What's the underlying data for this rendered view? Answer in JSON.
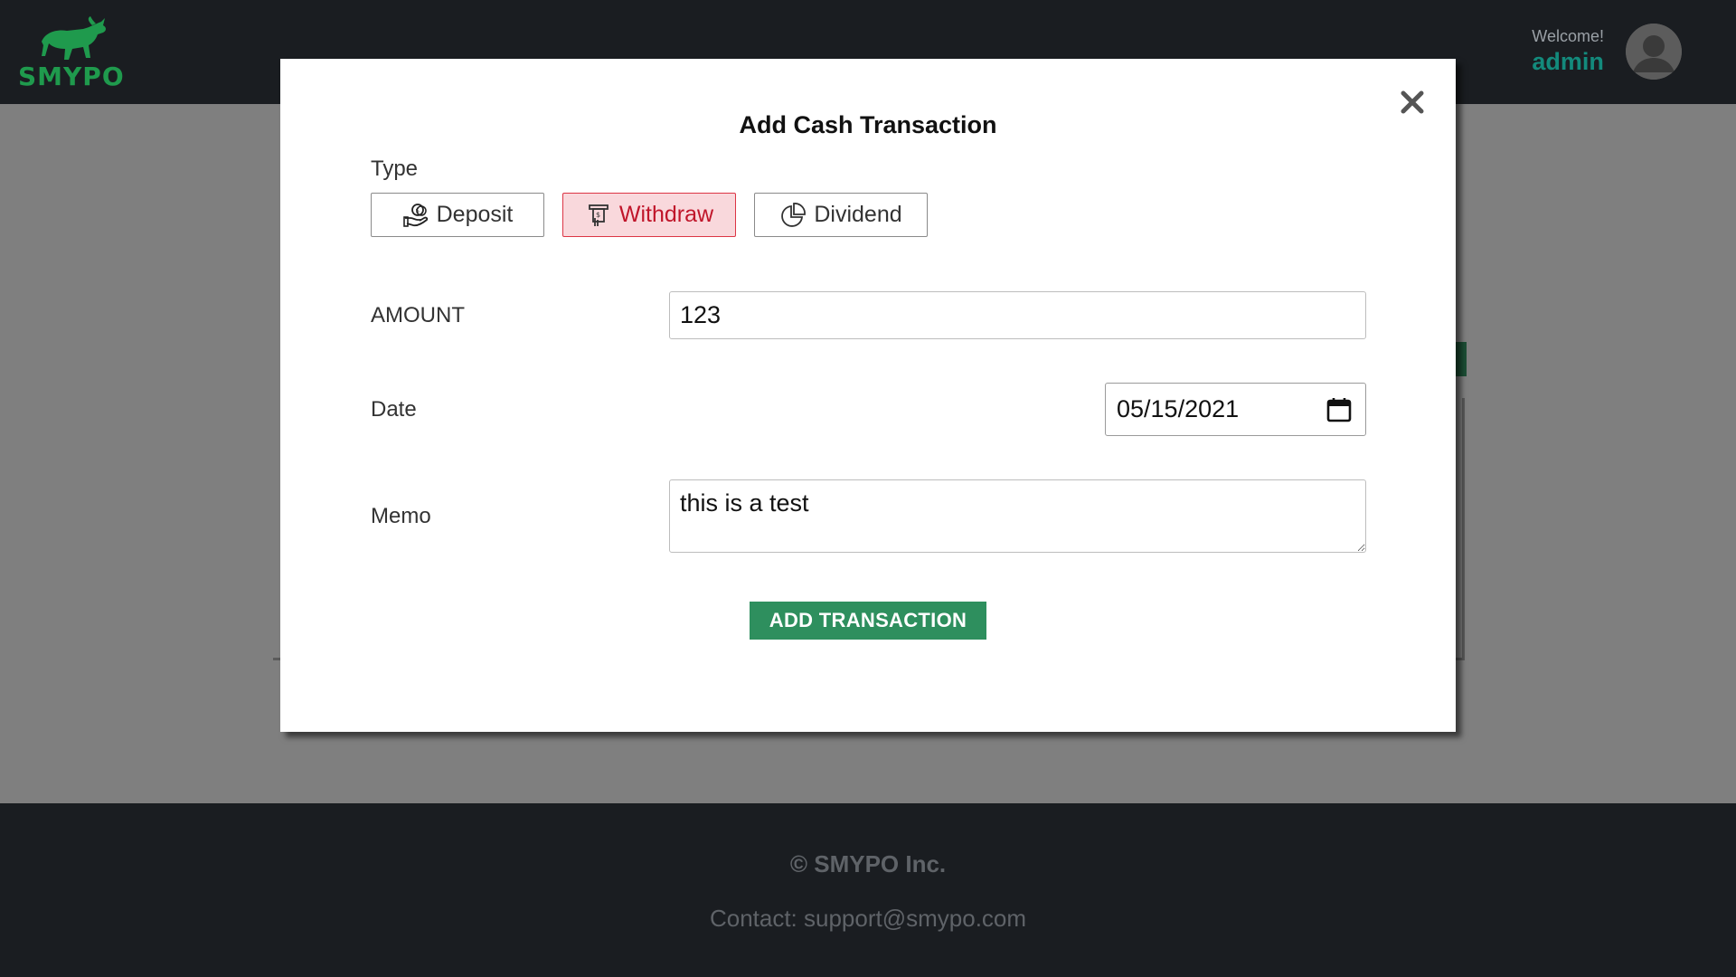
{
  "header": {
    "logo_text": "SMYPO",
    "welcome_label": "Welcome!",
    "username": "admin"
  },
  "modal": {
    "title": "Add Cash Transaction",
    "type_label": "Type",
    "types": [
      {
        "label": "Deposit",
        "icon": "hand-coins-icon",
        "active": false
      },
      {
        "label": "Withdraw",
        "icon": "atm-withdraw-icon",
        "active": true
      },
      {
        "label": "Dividend",
        "icon": "pie-chart-icon",
        "active": false
      }
    ],
    "amount_label": "AMOUNT",
    "amount_value": "123",
    "date_label": "Date",
    "date_value": "05/15/2021",
    "memo_label": "Memo",
    "memo_value": "this is a test",
    "submit_label": "ADD TRANSACTION"
  },
  "footer": {
    "copyright": "© SMYPO Inc.",
    "contact": "Contact: support@smypo.com"
  },
  "colors": {
    "brand_green": "#1f9a4d",
    "username_teal": "#138a7c",
    "active_bg": "#f9d8dc",
    "active_text": "#c0152a",
    "submit_bg": "#2e8f5e",
    "header_bg": "#1a1d21"
  }
}
